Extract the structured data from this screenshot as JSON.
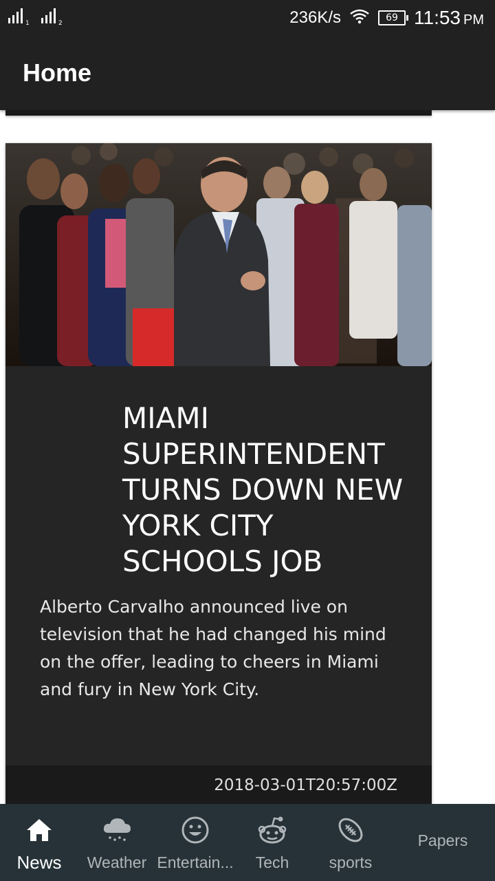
{
  "status_bar": {
    "network_speed": "236K/s",
    "battery_level": "69",
    "time": "11:53",
    "ampm": "PM"
  },
  "app_bar": {
    "title": "Home"
  },
  "article": {
    "headline": "MIAMI SUPERINTENDENT TURNS DOWN NEW YORK CITY SCHOOLS JOB",
    "summary": "Alberto Carvalho announced live on television that he had changed his mind on the offer, leading to cheers in Miami and fury in New York City.",
    "published": "2018-03-01T20:57:00Z"
  },
  "bottom_nav": {
    "items": [
      {
        "label": "News",
        "icon": "home-icon",
        "active": true
      },
      {
        "label": "Weather",
        "icon": "cloud-rain-icon",
        "active": false
      },
      {
        "label": "Entertain...",
        "icon": "smiley-icon",
        "active": false
      },
      {
        "label": "Tech",
        "icon": "reddit-icon",
        "active": false
      },
      {
        "label": "sports",
        "icon": "football-icon",
        "active": false
      },
      {
        "label": "Papers",
        "icon": "",
        "active": false
      }
    ]
  },
  "colors": {
    "app_bar": "#212121",
    "card": "#252525",
    "bottom_nav": "#263238",
    "active_label": "#ffffff",
    "inactive_label": "#b0b6b9"
  }
}
